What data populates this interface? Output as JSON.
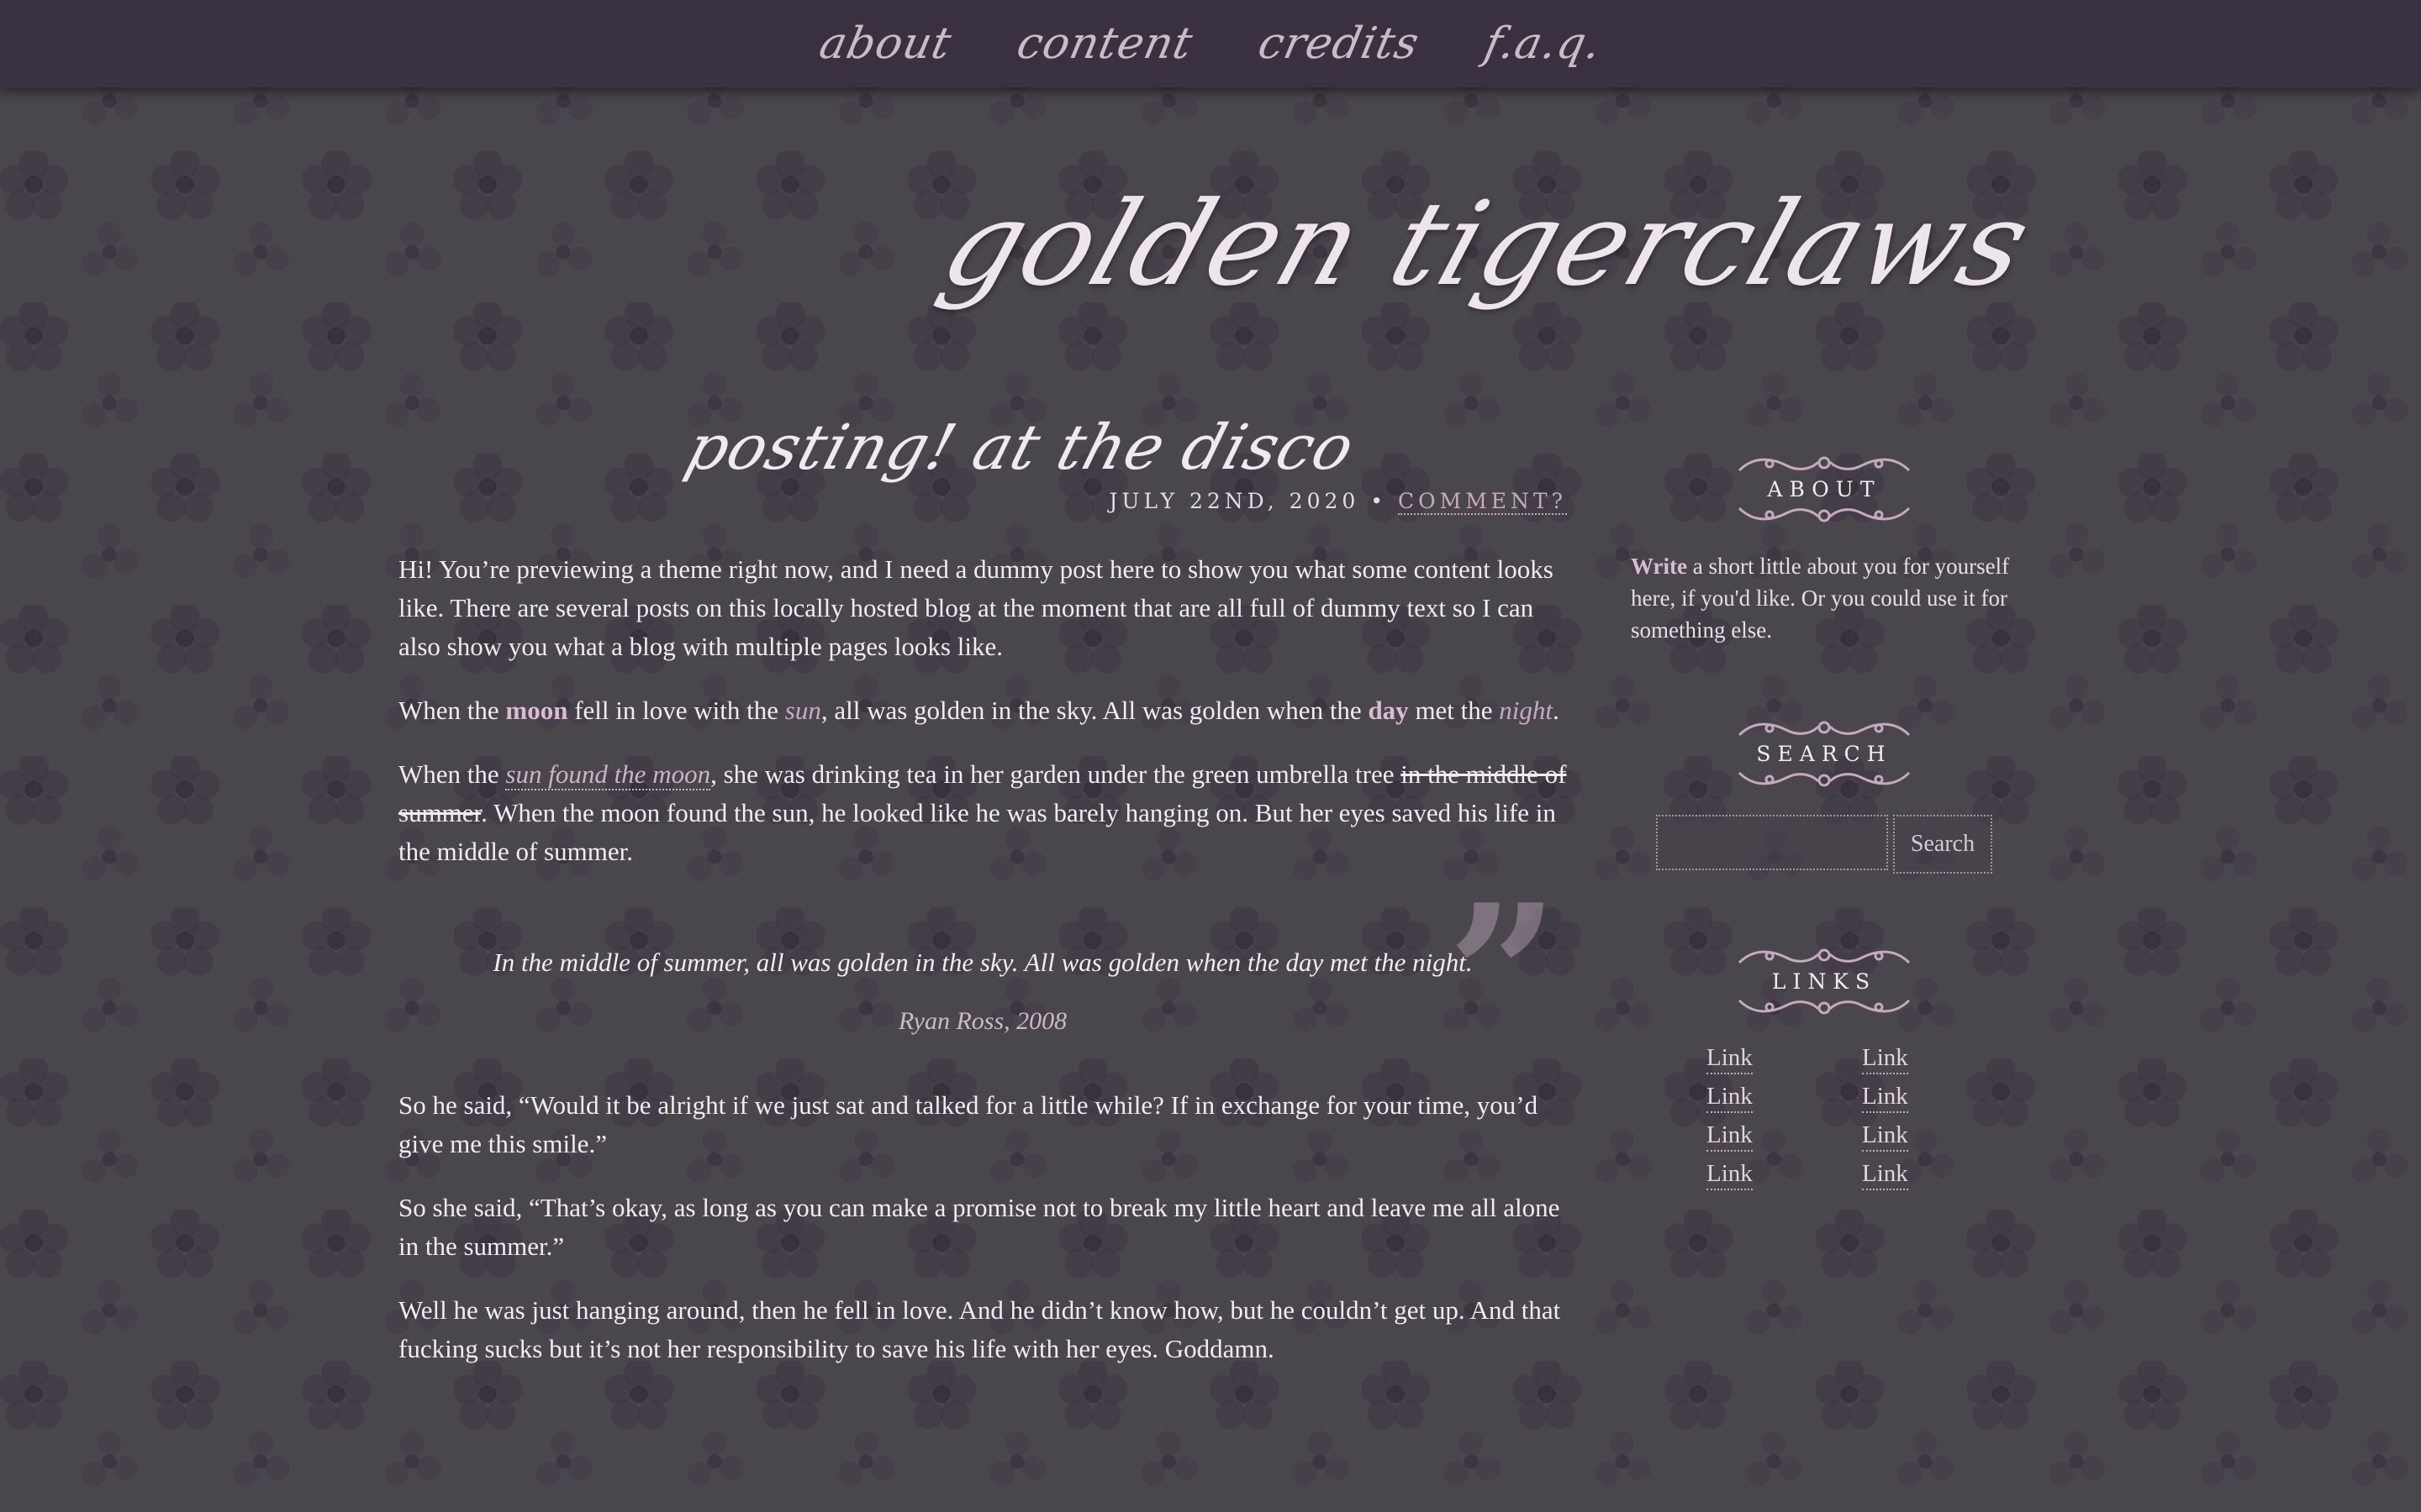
{
  "nav": {
    "items": [
      {
        "label": "about"
      },
      {
        "label": "content"
      },
      {
        "label": "credits"
      },
      {
        "label": "f.a.q."
      }
    ]
  },
  "blog": {
    "title": "golden tigerclaws"
  },
  "post": {
    "title": "posting! at the disco",
    "date": "JULY 22ND, 2020",
    "separator": "•",
    "comment_label": "COMMENT?",
    "p1": "Hi! You’re previewing a theme right now, and I need a dummy post here to show you what some content looks like. There are several posts on this locally hosted blog at the moment that are all full of dummy text so I can also show you what a blog with multiple pages looks like.",
    "p2": {
      "t1": "When the ",
      "moon": "moon",
      "t2": " fell in love with the ",
      "sun": "sun",
      "t3": ", all was golden in the sky. All was golden when the ",
      "day": "day",
      "t4": " met the ",
      "night": "night",
      "t5": "."
    },
    "p3": {
      "t1": "When the ",
      "link": "sun found the moon",
      "t2": ", she was drinking tea in her garden under the green umbrella tree ",
      "strike": "in the middle of summer",
      "t3": ". When the moon found the sun, he looked like he was barely hanging on. But her eyes saved his life in the middle of summer."
    },
    "quote": {
      "mark": "”",
      "text": "In the middle of summer, all was golden in the sky. All was golden when the day met the night.",
      "cite": "Ryan Ross, 2008"
    },
    "p4": "So he said, “Would it be alright if we just sat and talked for a little while? If in exchange for your time, you’d give me this smile.”",
    "p5": "So she said, “That’s okay, as long as you can make a promise not to break my little heart and leave me all alone in the summer.”",
    "p6": "Well he was just hanging around, then he fell in love. And he didn’t know how, but he couldn’t get up. And that fucking sucks but it’s not her responsibility to save his life with her eyes. Goddamn."
  },
  "sidebar": {
    "about": {
      "title": "ABOUT",
      "bold": "Write",
      "text": " a short little about you for yourself here, if you'd like. Or you could use it for something else."
    },
    "search": {
      "title": "SEARCH",
      "input_value": "",
      "button_label": "Search"
    },
    "links": {
      "title": "LINKS",
      "items": [
        "Link",
        "Link",
        "Link",
        "Link",
        "Link",
        "Link",
        "Link",
        "Link"
      ]
    }
  },
  "colors": {
    "background": "#4a474c",
    "nav_bar": "#3a3140",
    "accent": "#d9bcd3",
    "text": "#f2ecef"
  },
  "icons": {
    "divider": "ornamental-scroll-divider",
    "quote": "closing-quote-mark"
  }
}
